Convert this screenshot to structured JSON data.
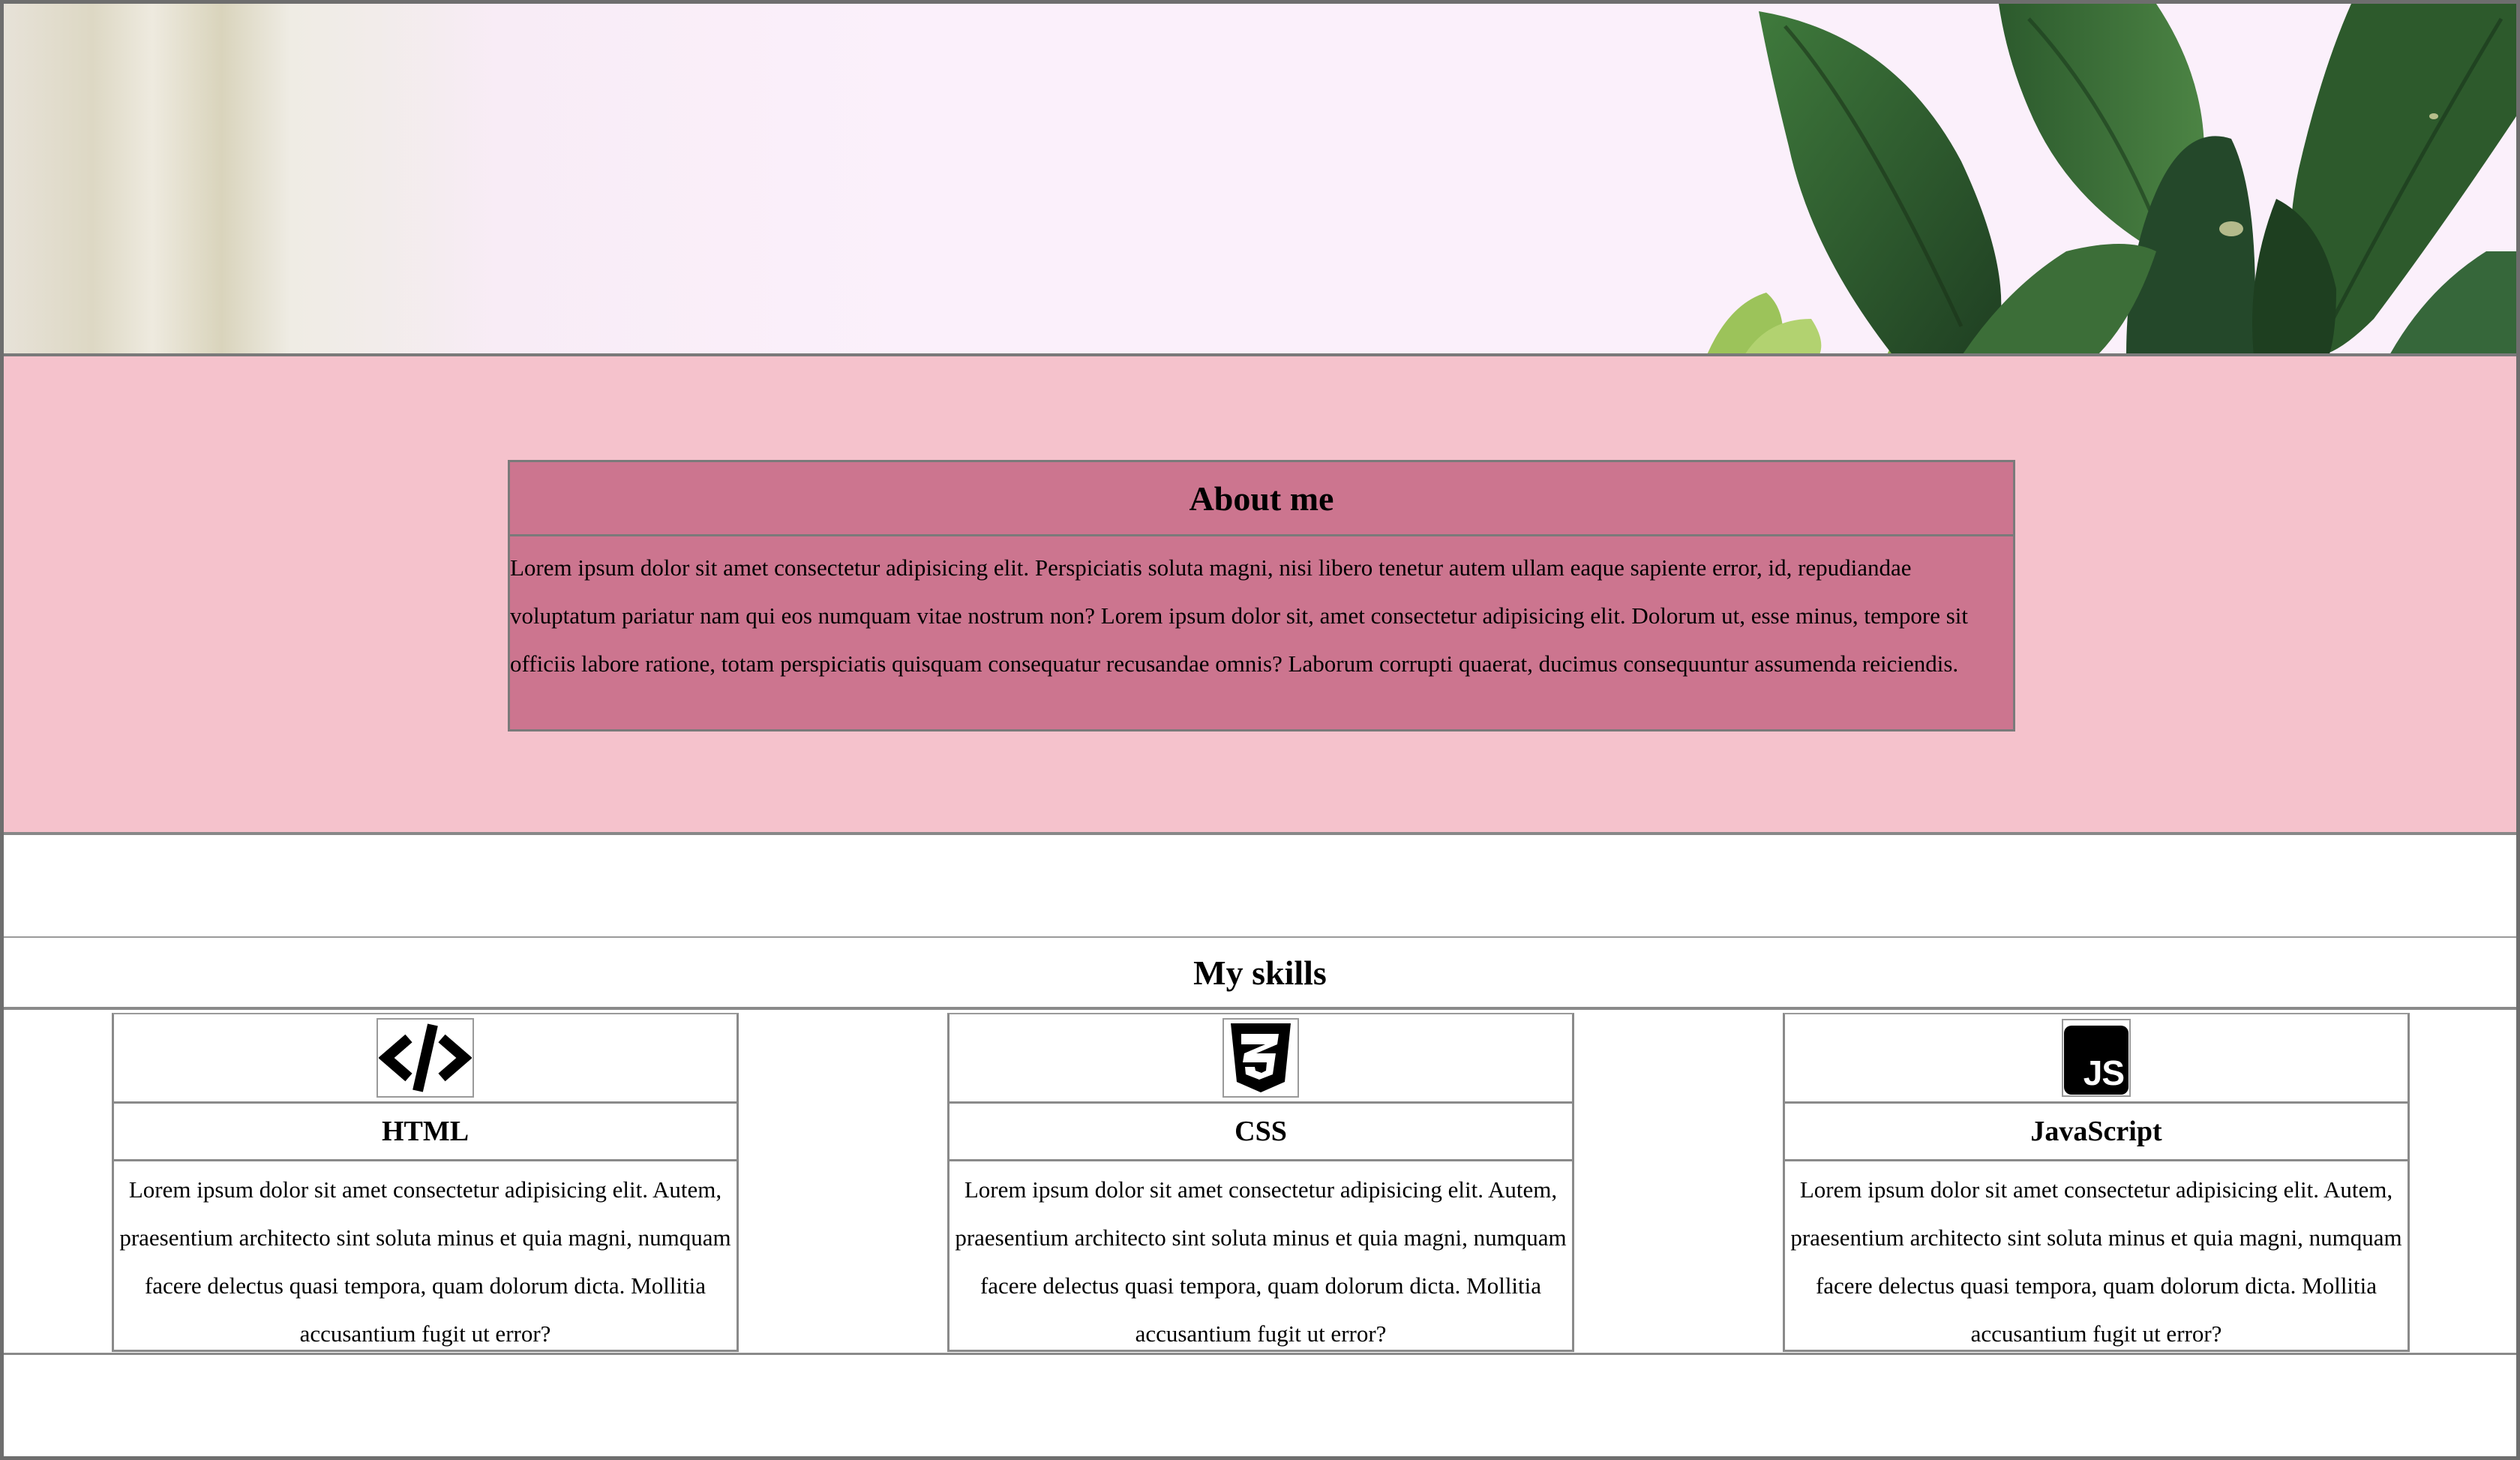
{
  "about": {
    "title": "About me",
    "text": "Lorem ipsum dolor sit amet consectetur adipisicing elit. Perspiciatis soluta magni, nisi libero tenetur autem ullam eaque sapiente error, id, repudiandae voluptatum pariatur nam qui eos numquam vitae nostrum non? Lorem ipsum dolor sit, amet consectetur adipisicing elit. Dolorum ut, esse minus, tempore sit officiis labore ratione, totam perspiciatis quisquam consequatur recusandae omnis? Laborum corrupti quaerat, ducimus consequuntur assumenda reiciendis."
  },
  "skills": {
    "title": "My skills",
    "items": [
      {
        "name": "HTML",
        "icon": "code-icon",
        "text": "Lorem ipsum dolor sit amet consectetur adipisicing elit. Autem, praesentium architecto sint soluta minus et quia magni, numquam facere delectus quasi tempora, quam dolorum dicta. Mollitia accusantium fugit ut error?"
      },
      {
        "name": "CSS",
        "icon": "css3-icon",
        "text": "Lorem ipsum dolor sit amet consectetur adipisicing elit. Autem, praesentium architecto sint soluta minus et quia magni, numquam facere delectus quasi tempora, quam dolorum dicta. Mollitia accusantium fugit ut error?"
      },
      {
        "name": "JavaScript",
        "icon": "javascript-icon",
        "text": "Lorem ipsum dolor sit amet consectetur adipisicing elit. Autem, praesentium architecto sint soluta minus et quia magni, numquam facere delectus quasi tempora, quam dolorum dicta. Mollitia accusantium fugit ut error?"
      }
    ]
  },
  "icons": {
    "js_label": "JS"
  },
  "colors": {
    "about_bg": "#f5c2cc",
    "about_card": "#cc758f",
    "hero_bg": "#fbf0fb",
    "plant_green": "#2e5a2c"
  }
}
